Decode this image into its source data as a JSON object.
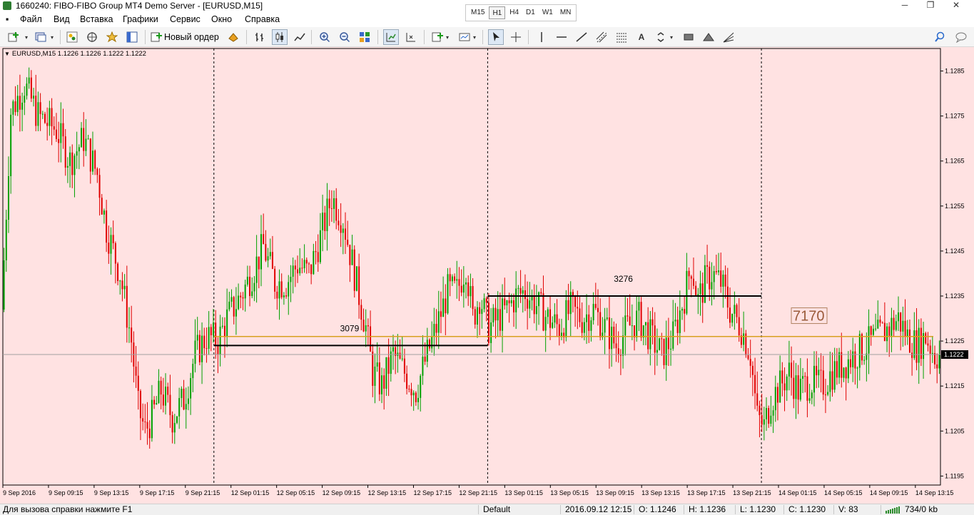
{
  "window": {
    "title": "1660240: FIBO-FIBO Group MT4 Demo Server - [EURUSD,M15]",
    "minimize": "─",
    "restore": "❐",
    "close": "✕"
  },
  "timeframes": [
    "M15",
    "H1",
    "H4",
    "D1",
    "W1",
    "MN"
  ],
  "active_timeframe": "H1",
  "menu": [
    "Файл",
    "Вид",
    "Вставка",
    "Графики",
    "Сервис",
    "Окно",
    "Справка"
  ],
  "toolbar": {
    "new_order_label": "Новый ордер",
    "icons": [
      "new-chart-icon",
      "profiles-icon",
      "market-watch-icon",
      "navigator-icon",
      "favorites-icon",
      "terminal-icon",
      "autotrading-icon",
      "bar-chart-icon",
      "candlestick-icon",
      "line-chart-icon",
      "zoom-in-icon",
      "zoom-out-icon",
      "tile-windows-icon",
      "chart-shift-icon",
      "autoscroll-icon",
      "indicators-icon",
      "periods-icon",
      "cursor-icon",
      "crosshair-icon",
      "vertical-line-icon",
      "horizontal-line-icon",
      "trendline-icon",
      "equidistant-channel-icon",
      "fibonacci-icon",
      "text-icon",
      "arrows-icon",
      "rectangle-icon",
      "triangle-icon",
      "fibo-fan-icon",
      "search-icon",
      "chat-icon"
    ]
  },
  "chart": {
    "symbol_label": "EURUSD,M15  1.1226 1.1226 1.1222 1.1222",
    "current_price": "1.1222",
    "colors": {
      "background": "#ffe2e2",
      "bull": "#00a000",
      "bear": "#e00000",
      "level": "#d8a020",
      "line": "#000000"
    },
    "annotations": [
      "3079",
      "3276",
      "7170"
    ]
  },
  "chart_data": {
    "type": "candlestick",
    "symbol": "EURUSD",
    "timeframe": "M15",
    "ohlc": {
      "open": 1.1226,
      "high": 1.1226,
      "low": 1.1222,
      "close": 1.1222
    },
    "ylim": [
      1.1193,
      1.129
    ],
    "y_ticks": [
      "1.1285",
      "1.1275",
      "1.1265",
      "1.1255",
      "1.1245",
      "1.1235",
      "1.1225",
      "1.1215",
      "1.1205",
      "1.1195"
    ],
    "x_ticks": [
      "9 Sep 2016",
      "9 Sep 09:15",
      "9 Sep 13:15",
      "9 Sep 17:15",
      "9 Sep 21:15",
      "12 Sep 01:15",
      "12 Sep 05:15",
      "12 Sep 09:15",
      "12 Sep 13:15",
      "12 Sep 17:15",
      "12 Sep 21:15",
      "13 Sep 01:15",
      "13 Sep 05:15",
      "13 Sep 09:15",
      "13 Sep 13:15",
      "13 Sep 17:15",
      "13 Sep 21:15",
      "14 Sep 01:15",
      "14 Sep 05:15",
      "14 Sep 09:15",
      "14 Sep 13:15"
    ],
    "session_separators": [
      "9 Sep 21:15",
      "12 Sep 21:15",
      "13 Sep 21:15"
    ],
    "horizontal_levels": [
      {
        "price": 1.1226,
        "color": "#d8a020",
        "from": "9 Sep 21:15",
        "to": "14 Sep 13:15"
      },
      {
        "price": 1.1224,
        "color": "#000000",
        "from": "9 Sep 21:15",
        "to": "12 Sep 21:15",
        "label": "3079"
      },
      {
        "price": 1.1235,
        "color": "#000000",
        "from": "12 Sep 21:15",
        "to": "13 Sep 21:15",
        "label": "3276"
      }
    ],
    "text_labels": [
      {
        "text": "7170",
        "price": 1.123,
        "time": "14 Sep 01:15"
      }
    ],
    "path": [
      [
        0,
        1.1232
      ],
      [
        4,
        1.1276
      ],
      [
        10,
        1.1282
      ],
      [
        16,
        1.1275
      ],
      [
        24,
        1.1272
      ],
      [
        30,
        1.1265
      ],
      [
        36,
        1.127
      ],
      [
        42,
        1.1262
      ],
      [
        46,
        1.125
      ],
      [
        52,
        1.124
      ],
      [
        57,
        1.1225
      ],
      [
        60,
        1.121
      ],
      [
        63,
        1.1205
      ],
      [
        66,
        1.1208
      ],
      [
        70,
        1.1214
      ],
      [
        75,
        1.1208
      ],
      [
        80,
        1.1212
      ],
      [
        85,
        1.1222
      ],
      [
        90,
        1.1226
      ],
      [
        95,
        1.1225
      ],
      [
        99,
        1.123
      ],
      [
        105,
        1.1235
      ],
      [
        110,
        1.124
      ],
      [
        115,
        1.1246
      ],
      [
        120,
        1.1238
      ],
      [
        125,
        1.1238
      ],
      [
        130,
        1.1242
      ],
      [
        135,
        1.124
      ],
      [
        140,
        1.1248
      ],
      [
        145,
        1.1257
      ],
      [
        150,
        1.1252
      ],
      [
        155,
        1.124
      ],
      [
        160,
        1.1228
      ],
      [
        163,
        1.1218
      ],
      [
        167,
        1.1215
      ],
      [
        172,
        1.1222
      ],
      [
        177,
        1.1218
      ],
      [
        182,
        1.1214
      ],
      [
        187,
        1.1222
      ],
      [
        191,
        1.1228
      ],
      [
        196,
        1.1236
      ],
      [
        200,
        1.1236
      ],
      [
        204,
        1.1242
      ],
      [
        207,
        1.123
      ],
      [
        210,
        1.1235
      ],
      [
        214,
        1.1228
      ],
      [
        218,
        1.123
      ],
      [
        222,
        1.1232
      ],
      [
        226,
        1.1235
      ],
      [
        230,
        1.1236
      ],
      [
        235,
        1.1233
      ],
      [
        240,
        1.123
      ],
      [
        245,
        1.1228
      ],
      [
        250,
        1.1232
      ],
      [
        255,
        1.123
      ],
      [
        260,
        1.1232
      ],
      [
        265,
        1.1228
      ],
      [
        270,
        1.1224
      ],
      [
        275,
        1.1228
      ],
      [
        280,
        1.123
      ],
      [
        285,
        1.1226
      ],
      [
        290,
        1.1222
      ],
      [
        295,
        1.1226
      ],
      [
        300,
        1.1235
      ],
      [
        303,
        1.1242
      ],
      [
        306,
        1.1234
      ],
      [
        309,
        1.1238
      ],
      [
        312,
        1.124
      ],
      [
        316,
        1.1238
      ],
      [
        320,
        1.1232
      ],
      [
        325,
        1.1228
      ],
      [
        329,
        1.1222
      ],
      [
        332,
        1.1208
      ],
      [
        335,
        1.1206
      ],
      [
        338,
        1.1212
      ],
      [
        342,
        1.1215
      ],
      [
        346,
        1.1218
      ],
      [
        350,
        1.1214
      ],
      [
        355,
        1.1216
      ],
      [
        360,
        1.1215
      ],
      [
        365,
        1.1218
      ],
      [
        370,
        1.122
      ],
      [
        375,
        1.1222
      ],
      [
        380,
        1.1224
      ],
      [
        385,
        1.1226
      ],
      [
        390,
        1.1228
      ],
      [
        394,
        1.123
      ],
      [
        398,
        1.1226
      ],
      [
        402,
        1.1224
      ],
      [
        406,
        1.1226
      ],
      [
        410,
        1.1222
      ]
    ]
  },
  "status": {
    "help": "Для вызова справки нажмите F1",
    "profile": "Default",
    "datetime": "2016.09.12 12:15",
    "open": "O: 1.1246",
    "high": "H: 1.1236",
    "low": "L: 1.1230",
    "close": "C: 1.1230",
    "volume": "V: 83",
    "traffic": "734/0 kb"
  }
}
